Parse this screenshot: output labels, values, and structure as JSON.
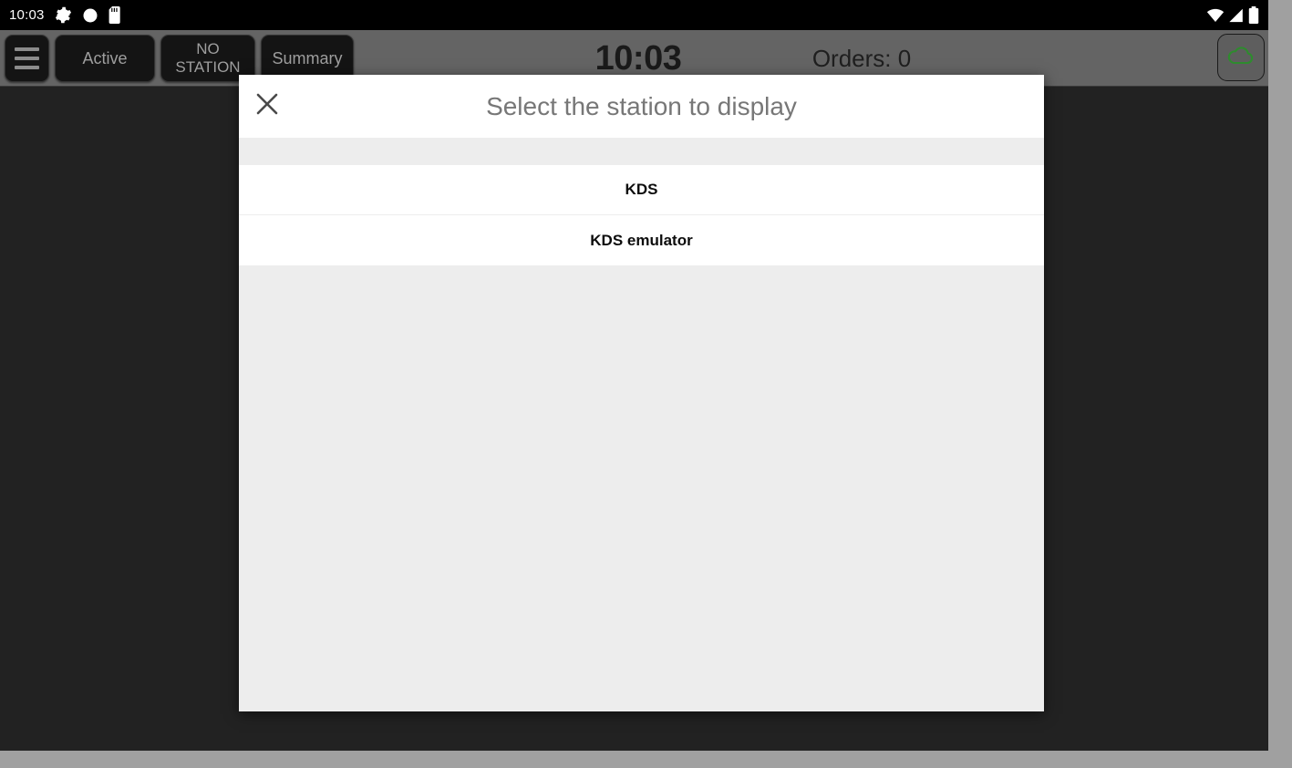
{
  "status_bar": {
    "clock": "10:03",
    "icons_left": [
      "gear-icon",
      "circle-icon",
      "sd-card-icon"
    ],
    "icons_right": [
      "wifi-icon",
      "cellular-signal-icon",
      "battery-icon"
    ]
  },
  "toolbar": {
    "menu_icon": "hamburger-menu-icon",
    "active_label": "Active",
    "station_label_line1": "NO",
    "station_label_line2": "STATION",
    "summary_label": "Summary",
    "clock": "10:03",
    "orders": "Orders: 0",
    "cloud_icon": "cloud-icon",
    "cloud_color": "#2e8b2e",
    "background": "#646464",
    "button_background": "#141414",
    "button_text_color": "#9e9e9e"
  },
  "dialog": {
    "close_icon": "close-x-icon",
    "title": "Select the station to display",
    "title_color": "#777777",
    "background": "#ededed",
    "items": [
      {
        "label": "KDS"
      },
      {
        "label": "KDS emulator"
      }
    ]
  },
  "content": {
    "background": "#222222"
  }
}
